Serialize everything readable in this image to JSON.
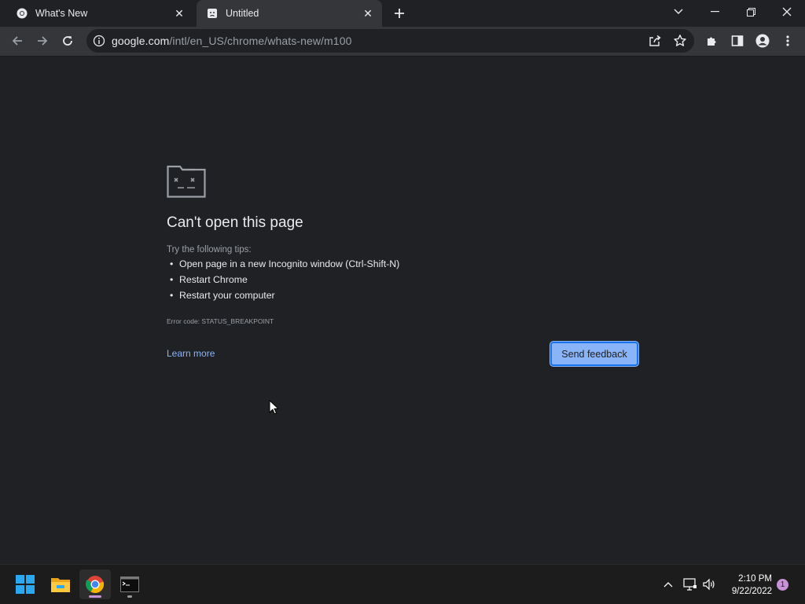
{
  "tabs": [
    {
      "title": "What's New",
      "icon": "chrome-icon",
      "active": false
    },
    {
      "title": "Untitled",
      "icon": "sad-page-icon",
      "active": true
    }
  ],
  "omnibox": {
    "host": "google.com",
    "path": "/intl/en_US/chrome/whats-new/m100"
  },
  "error_page": {
    "heading": "Can't open this page",
    "tips_intro": "Try the following tips:",
    "tips": [
      "Open page in a new Incognito window (Ctrl-Shift-N)",
      "Restart Chrome",
      "Restart your computer"
    ],
    "error_code": "Error code: STATUS_BREAKPOINT",
    "learn_more": "Learn more",
    "send_feedback": "Send feedback"
  },
  "taskbar": {
    "apps": [
      "start-icon",
      "file-explorer-icon",
      "chrome-icon",
      "terminal-icon"
    ],
    "time": "2:10 PM",
    "date": "9/22/2022",
    "notification_count": "1"
  },
  "colors": {
    "background": "#202124",
    "toolbar": "#35363a",
    "link": "#8ab4f8",
    "button": "#8ab4f8",
    "button_border": "#1a73e8"
  }
}
